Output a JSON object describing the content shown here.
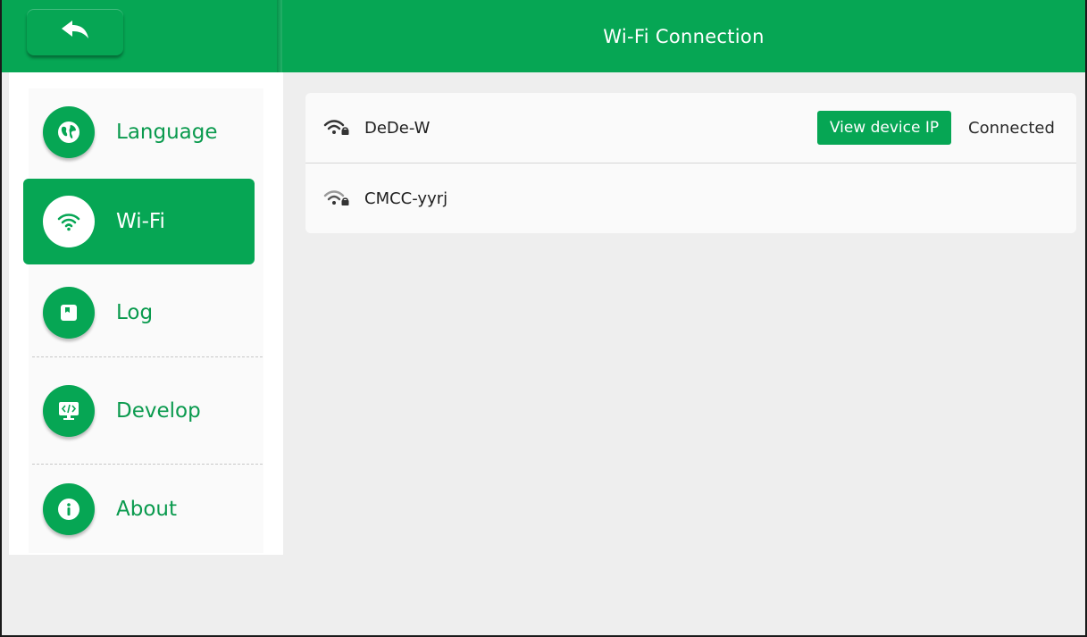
{
  "header": {
    "title": "Wi-Fi Connection",
    "back_icon": "back-arrow-icon"
  },
  "sidebar": {
    "items": [
      {
        "label": "Language",
        "icon": "globe-icon",
        "active": false
      },
      {
        "label": "Wi-Fi",
        "icon": "wifi-icon",
        "active": true
      },
      {
        "label": "Log",
        "icon": "log-icon",
        "active": false
      },
      {
        "label": "Develop",
        "icon": "develop-icon",
        "active": false
      },
      {
        "label": "About",
        "icon": "info-icon",
        "active": false
      }
    ]
  },
  "networks": [
    {
      "ssid": "DeDe-W",
      "icon": "wifi-locked-icon",
      "action_label": "View device IP",
      "status": "Connected"
    },
    {
      "ssid": "CMCC-yyrj",
      "icon": "wifi-locked-icon"
    }
  ],
  "colors": {
    "accent": "#06a654",
    "background": "#eeeeee",
    "panel": "#fafafa"
  }
}
